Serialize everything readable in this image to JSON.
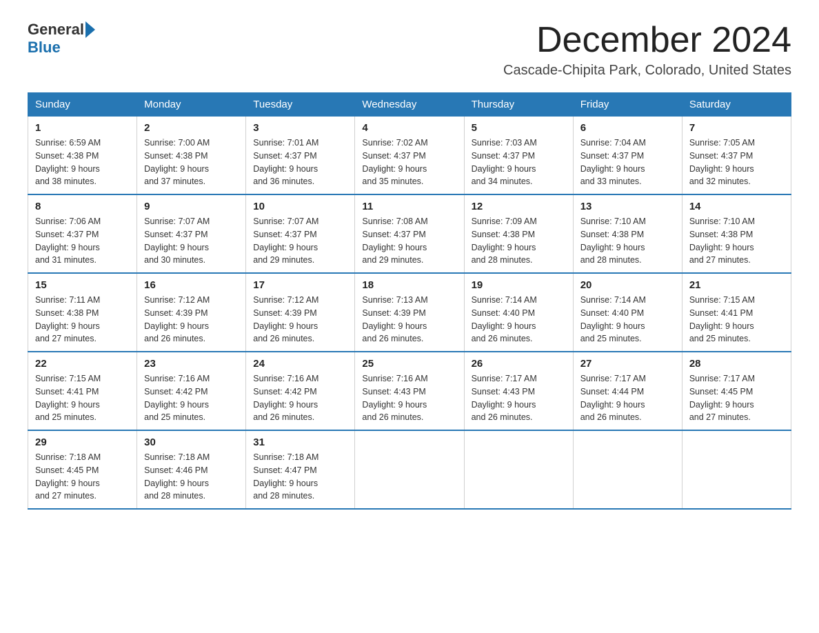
{
  "logo": {
    "general": "General",
    "blue": "Blue"
  },
  "title": {
    "month": "December 2024",
    "location": "Cascade-Chipita Park, Colorado, United States"
  },
  "days_of_week": [
    "Sunday",
    "Monday",
    "Tuesday",
    "Wednesday",
    "Thursday",
    "Friday",
    "Saturday"
  ],
  "weeks": [
    [
      {
        "day": "1",
        "sunrise": "6:59 AM",
        "sunset": "4:38 PM",
        "daylight": "9 hours and 38 minutes."
      },
      {
        "day": "2",
        "sunrise": "7:00 AM",
        "sunset": "4:38 PM",
        "daylight": "9 hours and 37 minutes."
      },
      {
        "day": "3",
        "sunrise": "7:01 AM",
        "sunset": "4:37 PM",
        "daylight": "9 hours and 36 minutes."
      },
      {
        "day": "4",
        "sunrise": "7:02 AM",
        "sunset": "4:37 PM",
        "daylight": "9 hours and 35 minutes."
      },
      {
        "day": "5",
        "sunrise": "7:03 AM",
        "sunset": "4:37 PM",
        "daylight": "9 hours and 34 minutes."
      },
      {
        "day": "6",
        "sunrise": "7:04 AM",
        "sunset": "4:37 PM",
        "daylight": "9 hours and 33 minutes."
      },
      {
        "day": "7",
        "sunrise": "7:05 AM",
        "sunset": "4:37 PM",
        "daylight": "9 hours and 32 minutes."
      }
    ],
    [
      {
        "day": "8",
        "sunrise": "7:06 AM",
        "sunset": "4:37 PM",
        "daylight": "9 hours and 31 minutes."
      },
      {
        "day": "9",
        "sunrise": "7:07 AM",
        "sunset": "4:37 PM",
        "daylight": "9 hours and 30 minutes."
      },
      {
        "day": "10",
        "sunrise": "7:07 AM",
        "sunset": "4:37 PM",
        "daylight": "9 hours and 29 minutes."
      },
      {
        "day": "11",
        "sunrise": "7:08 AM",
        "sunset": "4:37 PM",
        "daylight": "9 hours and 29 minutes."
      },
      {
        "day": "12",
        "sunrise": "7:09 AM",
        "sunset": "4:38 PM",
        "daylight": "9 hours and 28 minutes."
      },
      {
        "day": "13",
        "sunrise": "7:10 AM",
        "sunset": "4:38 PM",
        "daylight": "9 hours and 28 minutes."
      },
      {
        "day": "14",
        "sunrise": "7:10 AM",
        "sunset": "4:38 PM",
        "daylight": "9 hours and 27 minutes."
      }
    ],
    [
      {
        "day": "15",
        "sunrise": "7:11 AM",
        "sunset": "4:38 PM",
        "daylight": "9 hours and 27 minutes."
      },
      {
        "day": "16",
        "sunrise": "7:12 AM",
        "sunset": "4:39 PM",
        "daylight": "9 hours and 26 minutes."
      },
      {
        "day": "17",
        "sunrise": "7:12 AM",
        "sunset": "4:39 PM",
        "daylight": "9 hours and 26 minutes."
      },
      {
        "day": "18",
        "sunrise": "7:13 AM",
        "sunset": "4:39 PM",
        "daylight": "9 hours and 26 minutes."
      },
      {
        "day": "19",
        "sunrise": "7:14 AM",
        "sunset": "4:40 PM",
        "daylight": "9 hours and 26 minutes."
      },
      {
        "day": "20",
        "sunrise": "7:14 AM",
        "sunset": "4:40 PM",
        "daylight": "9 hours and 25 minutes."
      },
      {
        "day": "21",
        "sunrise": "7:15 AM",
        "sunset": "4:41 PM",
        "daylight": "9 hours and 25 minutes."
      }
    ],
    [
      {
        "day": "22",
        "sunrise": "7:15 AM",
        "sunset": "4:41 PM",
        "daylight": "9 hours and 25 minutes."
      },
      {
        "day": "23",
        "sunrise": "7:16 AM",
        "sunset": "4:42 PM",
        "daylight": "9 hours and 25 minutes."
      },
      {
        "day": "24",
        "sunrise": "7:16 AM",
        "sunset": "4:42 PM",
        "daylight": "9 hours and 26 minutes."
      },
      {
        "day": "25",
        "sunrise": "7:16 AM",
        "sunset": "4:43 PM",
        "daylight": "9 hours and 26 minutes."
      },
      {
        "day": "26",
        "sunrise": "7:17 AM",
        "sunset": "4:43 PM",
        "daylight": "9 hours and 26 minutes."
      },
      {
        "day": "27",
        "sunrise": "7:17 AM",
        "sunset": "4:44 PM",
        "daylight": "9 hours and 26 minutes."
      },
      {
        "day": "28",
        "sunrise": "7:17 AM",
        "sunset": "4:45 PM",
        "daylight": "9 hours and 27 minutes."
      }
    ],
    [
      {
        "day": "29",
        "sunrise": "7:18 AM",
        "sunset": "4:45 PM",
        "daylight": "9 hours and 27 minutes."
      },
      {
        "day": "30",
        "sunrise": "7:18 AM",
        "sunset": "4:46 PM",
        "daylight": "9 hours and 28 minutes."
      },
      {
        "day": "31",
        "sunrise": "7:18 AM",
        "sunset": "4:47 PM",
        "daylight": "9 hours and 28 minutes."
      },
      null,
      null,
      null,
      null
    ]
  ],
  "labels": {
    "sunrise": "Sunrise:",
    "sunset": "Sunset:",
    "daylight": "Daylight:"
  }
}
